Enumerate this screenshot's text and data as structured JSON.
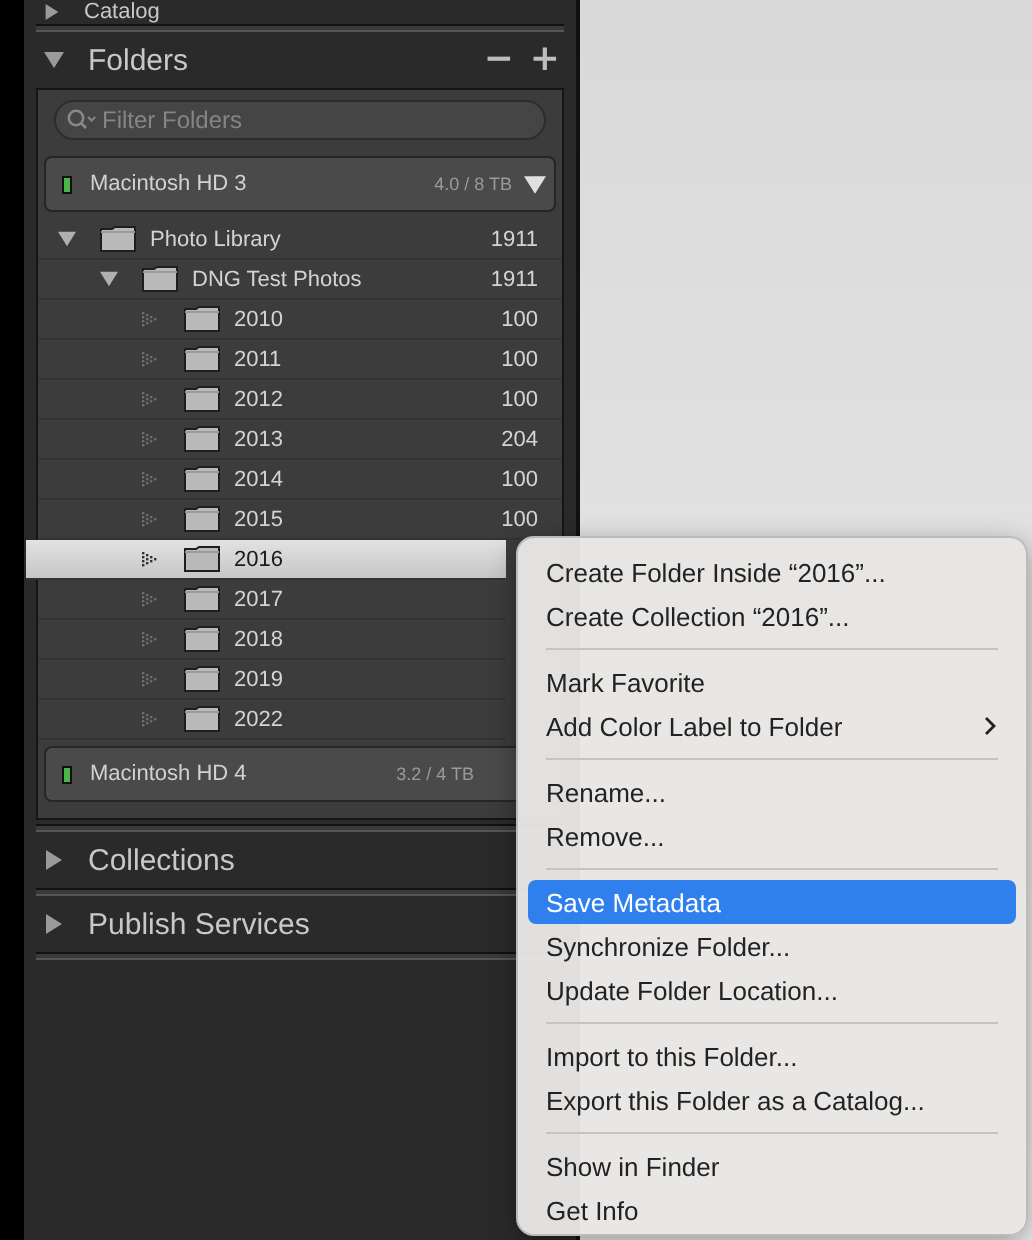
{
  "catalog_header": {
    "label": "Catalog",
    "expanded": false
  },
  "folders_panel": {
    "label": "Folders",
    "expanded": true,
    "minus": "−",
    "plus": "+",
    "filter": {
      "placeholder": "Filter Folders"
    },
    "volumes": [
      {
        "name": "Macintosh HD 3",
        "space": "4.0 / 8 TB",
        "expanded": true,
        "folders": [
          {
            "name": "Photo Library",
            "count": "1911",
            "expanded": true,
            "selected": false,
            "children": [
              {
                "name": "DNG Test Photos",
                "count": "1911",
                "expanded": true,
                "selected": false,
                "children": [
                  {
                    "name": "2010",
                    "count": "100",
                    "selected": false
                  },
                  {
                    "name": "2011",
                    "count": "100",
                    "selected": false
                  },
                  {
                    "name": "2012",
                    "count": "100",
                    "selected": false
                  },
                  {
                    "name": "2013",
                    "count": "204",
                    "selected": false
                  },
                  {
                    "name": "2014",
                    "count": "100",
                    "selected": false
                  },
                  {
                    "name": "2015",
                    "count": "100",
                    "selected": false
                  },
                  {
                    "name": "2016",
                    "selected": true
                  },
                  {
                    "name": "2017",
                    "selected": false
                  },
                  {
                    "name": "2018",
                    "selected": false
                  },
                  {
                    "name": "2019",
                    "selected": false
                  },
                  {
                    "name": "2022",
                    "selected": false
                  }
                ]
              }
            ]
          }
        ]
      },
      {
        "name": "Macintosh HD 4",
        "space": "3.2 / 4 TB",
        "expanded": false
      }
    ]
  },
  "sections": [
    {
      "label": "Collections",
      "expanded": false
    },
    {
      "label": "Publish Services",
      "expanded": false
    }
  ],
  "context_menu": [
    {
      "kind": "item",
      "label": "Create Folder Inside “2016”...",
      "selected": false
    },
    {
      "kind": "item",
      "label": "Create Collection “2016”...",
      "selected": false
    },
    {
      "kind": "separator"
    },
    {
      "kind": "item",
      "label": "Mark Favorite",
      "selected": false
    },
    {
      "kind": "item",
      "label": "Add Color Label to Folder",
      "selected": false,
      "submenu": true
    },
    {
      "kind": "separator"
    },
    {
      "kind": "item",
      "label": "Rename...",
      "selected": false
    },
    {
      "kind": "item",
      "label": "Remove...",
      "selected": false
    },
    {
      "kind": "separator"
    },
    {
      "kind": "item",
      "label": "Save Metadata",
      "selected": true
    },
    {
      "kind": "item",
      "label": "Synchronize Folder...",
      "selected": false
    },
    {
      "kind": "item",
      "label": "Update Folder Location...",
      "selected": false
    },
    {
      "kind": "separator"
    },
    {
      "kind": "item",
      "label": "Import to this Folder...",
      "selected": false
    },
    {
      "kind": "item",
      "label": "Export this Folder as a Catalog...",
      "selected": false
    },
    {
      "kind": "separator"
    },
    {
      "kind": "item",
      "label": "Show in Finder",
      "selected": false
    },
    {
      "kind": "item",
      "label": "Get Info",
      "selected": false
    }
  ]
}
